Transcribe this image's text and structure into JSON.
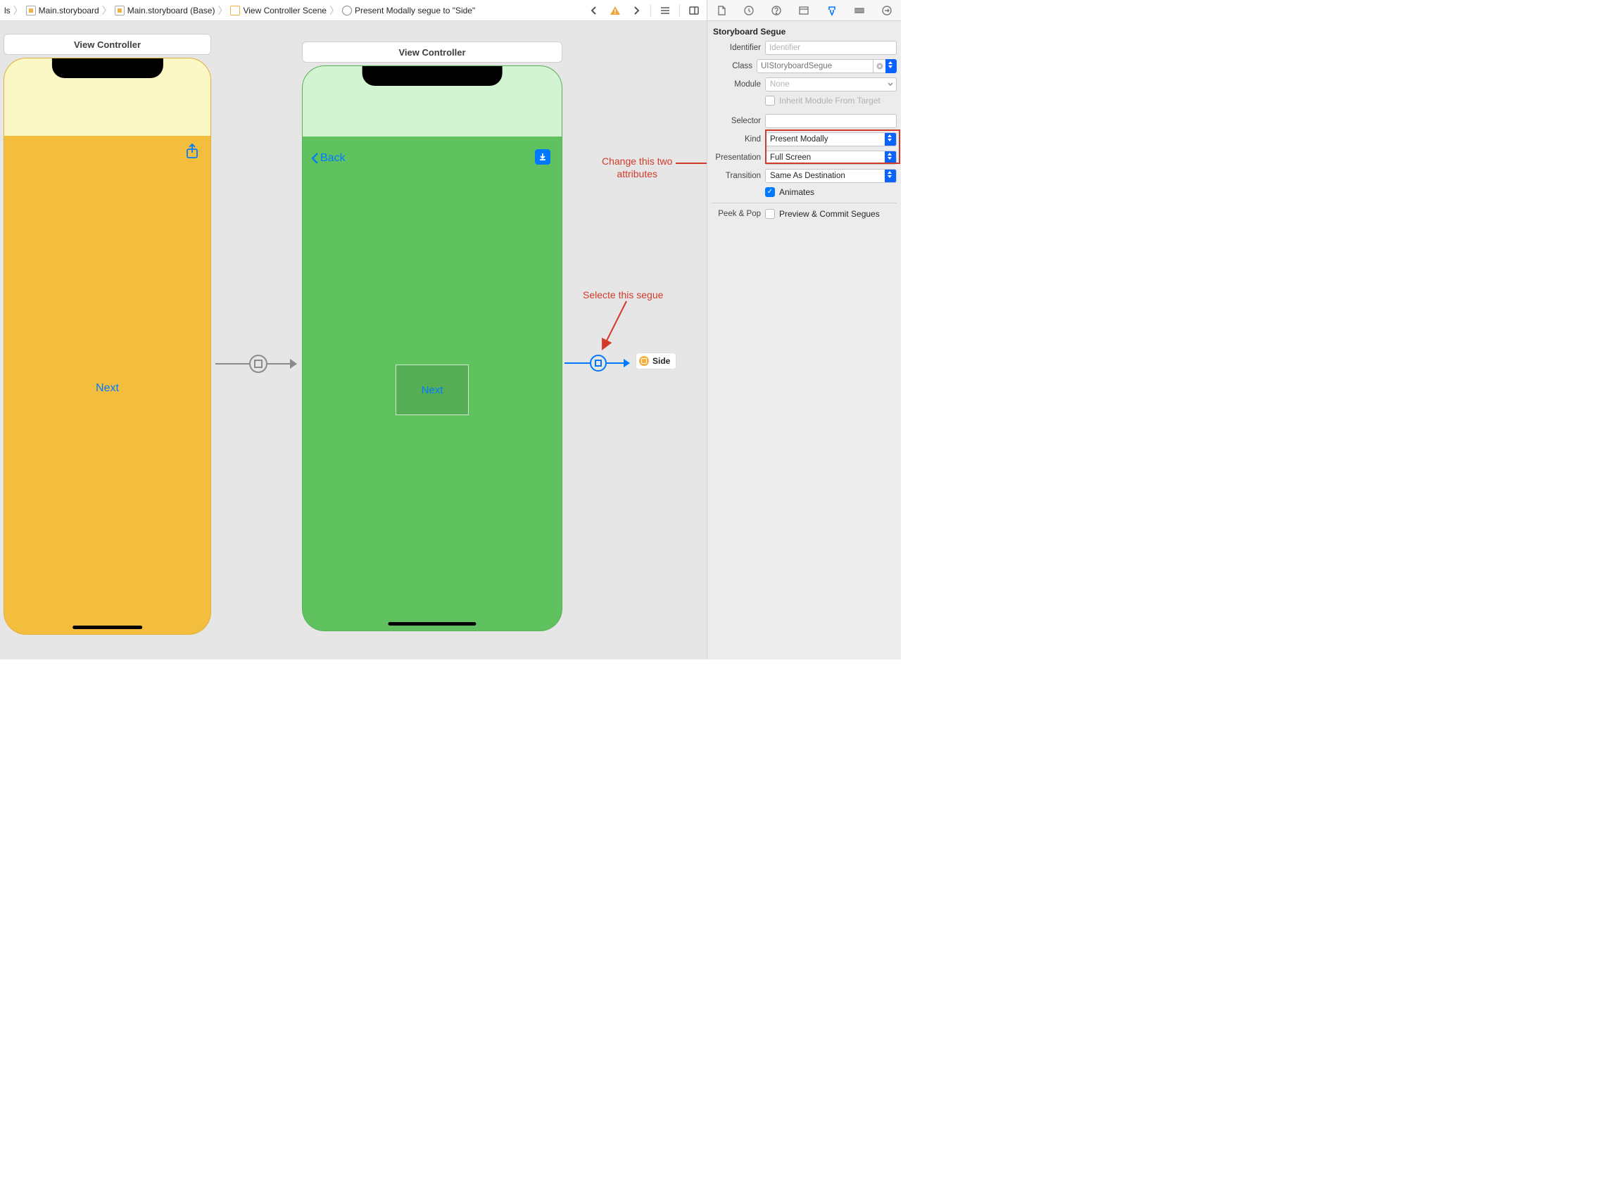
{
  "breadcrumb": {
    "item0": "ls",
    "item1": "Main.storyboard",
    "item2": "Main.storyboard (Base)",
    "item3": "View Controller Scene",
    "item4": "Present Modally segue to \"Side\""
  },
  "scene1": {
    "title": "View Controller",
    "button": "Next"
  },
  "scene2": {
    "title": "View Controller",
    "back": "Back",
    "button": "Next"
  },
  "side_chip": "Side",
  "annotation1_line1": "Change this two",
  "annotation1_line2": "attributes",
  "annotation2": "Selecte this segue",
  "inspector": {
    "header": "Storyboard Segue",
    "identifier_label": "Identifier",
    "identifier_placeholder": "Identifier",
    "class_label": "Class",
    "class_placeholder": "UIStoryboardSegue",
    "module_label": "Module",
    "module_placeholder": "None",
    "inherit_label": "Inherit Module From Target",
    "selector_label": "Selector",
    "kind_label": "Kind",
    "kind_value": "Present Modally",
    "presentation_label": "Presentation",
    "presentation_value": "Full Screen",
    "transition_label": "Transition",
    "transition_value": "Same As Destination",
    "animates_label": "Animates",
    "peekpop_label": "Peek & Pop",
    "peekpop_value": "Preview & Commit Segues"
  }
}
